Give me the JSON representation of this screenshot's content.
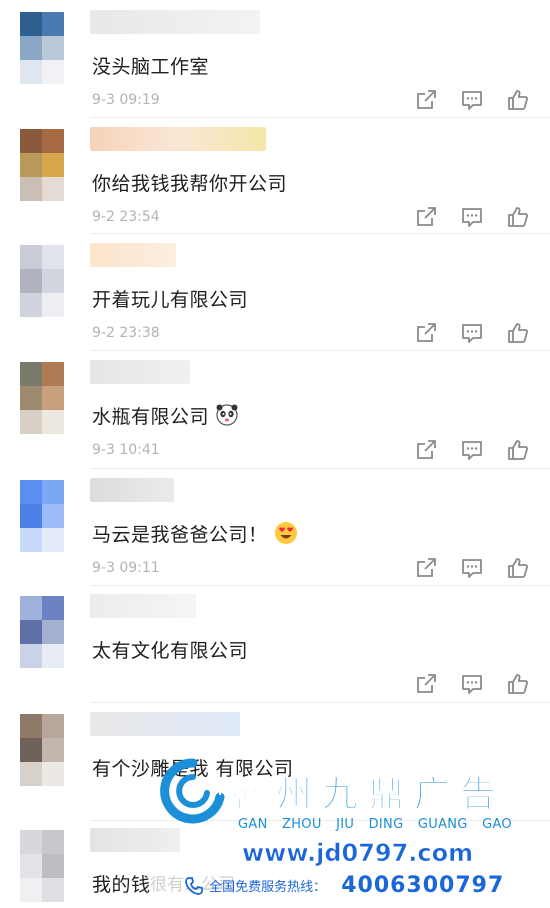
{
  "comments": [
    {
      "text": "没头脑工作室",
      "time": "9-3 09:19",
      "emoji": ""
    },
    {
      "text": "你给我钱我帮你开公司",
      "time": "9-2 23:54",
      "emoji": ""
    },
    {
      "text": "开着玩儿有限公司",
      "time": "9-2 23:38",
      "emoji": ""
    },
    {
      "text": "水瓶有限公司",
      "time": "9-3 10:41",
      "emoji": "panda-face-emoji"
    },
    {
      "text": "马云是我爸爸公司！",
      "time": "9-3 09:11",
      "emoji": "heart-eyes-emoji"
    },
    {
      "text": "太有文化有限公司",
      "time": "",
      "emoji": ""
    },
    {
      "text": "有个沙雕是我 有限公司",
      "time": "",
      "emoji": ""
    },
    {
      "text": "我的钱",
      "time": "",
      "emoji": ""
    }
  ],
  "overlay_text": "很有…公司",
  "actions": {
    "icons": [
      "share-icon",
      "comment-icon",
      "like-icon"
    ]
  },
  "ad": {
    "brand": "赣州九鼎广告",
    "pinyin": "GAN ZHOU JIU DING GUANG GAO",
    "url": "www.jd0797.com",
    "hotline_label": "全国免费服务热线：",
    "phone": "4006300797",
    "brand_color": "#1b8fd8",
    "accent_color": "#1b66d8"
  },
  "colors": {
    "text": "#1f1f1f",
    "time": "#b3b3b3",
    "icon": "#8a8a8a",
    "divider": "#ececec"
  }
}
